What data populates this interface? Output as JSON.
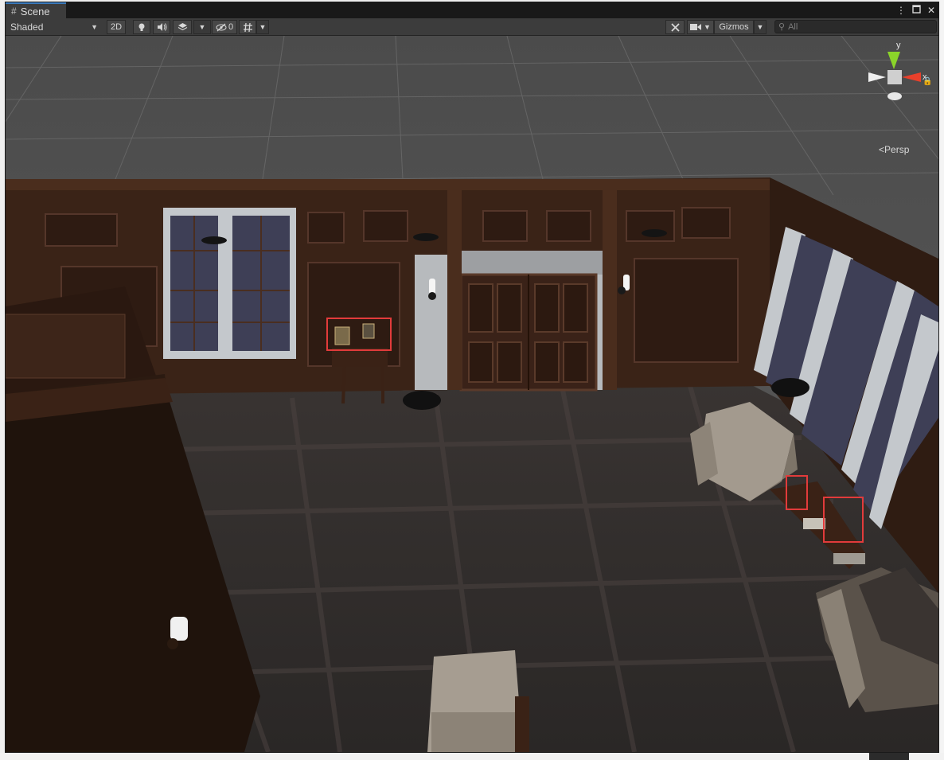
{
  "window": {
    "tab_title": "Scene",
    "tab_icon": "grid-hash-icon",
    "controls": [
      "kebab-menu-icon",
      "maximize-icon",
      "close-icon"
    ]
  },
  "toolbar": {
    "draw_mode": "Shaded",
    "mode_2d_label": "2D",
    "hidden_count": "0",
    "gizmos_label": "Gizmos",
    "search_placeholder": "All"
  },
  "viewport": {
    "projection_label": "Persp",
    "axis_labels": {
      "x": "x",
      "y": "y"
    },
    "colors": {
      "sky": "#5a5a5a",
      "grid": "#6b6b6b",
      "wood_panel": "#3b2418",
      "floor": "#2f2b2a",
      "highlight_box": "#e23b3b",
      "axis_x": "#e8402b",
      "axis_y": "#8bd42a"
    }
  }
}
